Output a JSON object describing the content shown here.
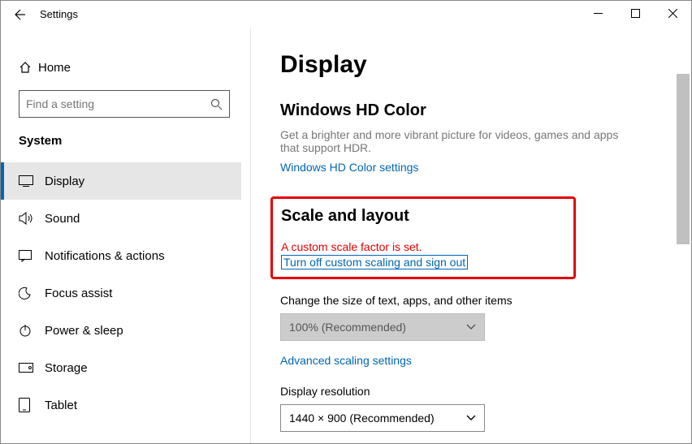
{
  "window": {
    "title": "Settings"
  },
  "sidebar": {
    "home": "Home",
    "search_placeholder": "Find a setting",
    "category": "System",
    "items": [
      {
        "label": "Display"
      },
      {
        "label": "Sound"
      },
      {
        "label": "Notifications & actions"
      },
      {
        "label": "Focus assist"
      },
      {
        "label": "Power & sleep"
      },
      {
        "label": "Storage"
      },
      {
        "label": "Tablet"
      }
    ]
  },
  "main": {
    "title": "Display",
    "hdcolor": {
      "heading": "Windows HD Color",
      "desc": "Get a brighter and more vibrant picture for videos, games and apps that support HDR.",
      "link": "Windows HD Color settings"
    },
    "scale": {
      "heading": "Scale and layout",
      "warning": "A custom scale factor is set.",
      "turn_off": "Turn off custom scaling and sign out",
      "size_label": "Change the size of text, apps, and other items",
      "size_value": "100% (Recommended)",
      "advanced": "Advanced scaling settings",
      "res_label": "Display resolution",
      "res_value": "1440 × 900 (Recommended)"
    }
  }
}
